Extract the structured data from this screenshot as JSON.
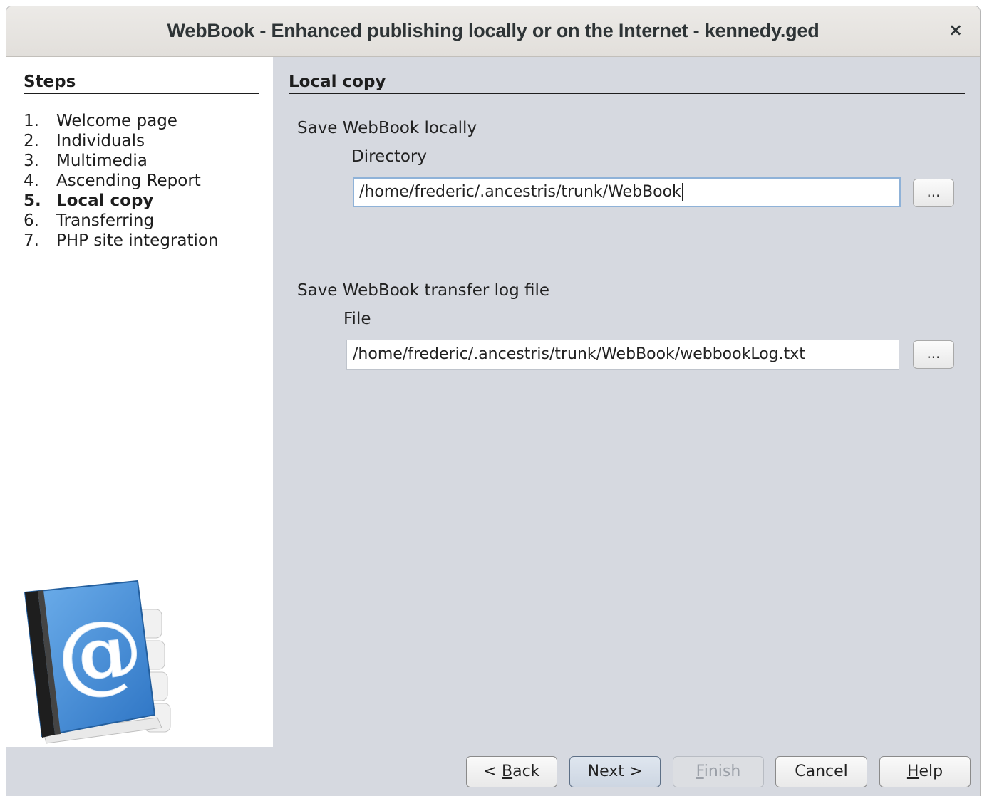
{
  "window": {
    "title": "WebBook - Enhanced publishing locally or on the Internet - kennedy.ged",
    "close_symbol": "×"
  },
  "steps": {
    "title": "Steps",
    "items": [
      {
        "num": "1.",
        "label": "Welcome page"
      },
      {
        "num": "2.",
        "label": "Individuals"
      },
      {
        "num": "3.",
        "label": "Multimedia"
      },
      {
        "num": "4.",
        "label": "Ascending Report"
      },
      {
        "num": "5.",
        "label": "Local copy",
        "active": true
      },
      {
        "num": "6.",
        "label": "Transferring"
      },
      {
        "num": "7.",
        "label": "PHP site integration"
      }
    ],
    "icon": "address-book-icon"
  },
  "content": {
    "title": "Local copy",
    "local": {
      "label": "Save WebBook locally",
      "directory_label": "Directory",
      "directory_value": "/home/frederic/.ancestris/trunk/WebBook",
      "browse_label": "..."
    },
    "log": {
      "label": "Save WebBook transfer log file",
      "file_label": "File",
      "file_value": "/home/frederic/.ancestris/trunk/WebBook/webbookLog.txt",
      "browse_label": "..."
    }
  },
  "buttons": {
    "back": {
      "pre": "< ",
      "mn": "B",
      "post": "ack"
    },
    "next": {
      "label": "Next >"
    },
    "finish": {
      "pre": "",
      "mn": "F",
      "post": "inish"
    },
    "cancel": {
      "label": "Cancel"
    },
    "help": {
      "pre": "",
      "mn": "H",
      "post": "elp"
    }
  },
  "colors": {
    "background": "#d6d9e0",
    "steps_panel": "#ffffff",
    "focus_border": "#8fb2d8",
    "book_blue": "#3d86d1"
  }
}
